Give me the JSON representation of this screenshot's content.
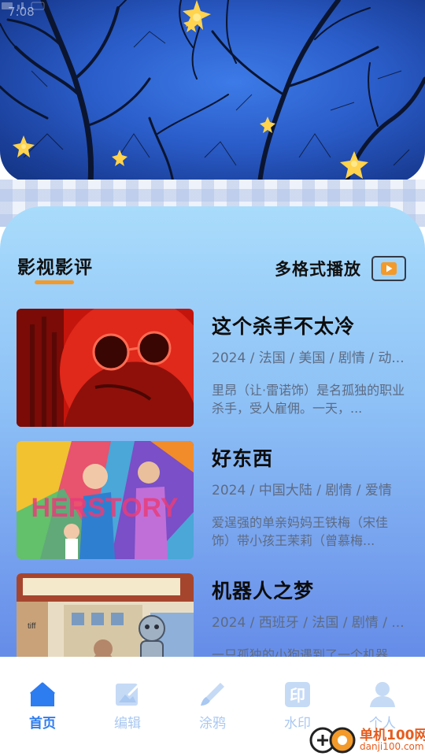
{
  "status_bar": {
    "time": "7:08"
  },
  "section": {
    "title": "影视影评",
    "action_label": "多格式播放"
  },
  "movies": [
    {
      "title": "这个杀手不太冷",
      "meta": "2024 / 法国 / 美国 / 剧情 / 动...",
      "desc": "里昂（让·雷诺饰）是名孤独的职业杀手，受人雇佣。一天，..."
    },
    {
      "title": "好东西",
      "meta": "2024 / 中国大陆 / 剧情 / 爱情",
      "desc": "爱逞强的单亲妈妈王铁梅（宋佳饰）带小孩王茉莉（曾慕梅...",
      "poster_text": "HERSTORY"
    },
    {
      "title": "机器人之梦",
      "meta": "2024 / 西班牙 / 法国 / 剧情 / ...",
      "desc": "一只孤独的小狗遇到了一个机器人..."
    }
  ],
  "nav": [
    {
      "label": "首页",
      "icon": "home-icon",
      "active": true
    },
    {
      "label": "编辑",
      "icon": "edit-image-icon",
      "active": false
    },
    {
      "label": "涂鸦",
      "icon": "brush-icon",
      "active": false
    },
    {
      "label": "水印",
      "icon": "stamp-icon",
      "active": false
    },
    {
      "label": "个人",
      "icon": "person-icon",
      "active": false
    }
  ],
  "watermark": {
    "name": "单机100网",
    "url": "danji100.com"
  },
  "colors": {
    "accent": "#2d7cf0",
    "underline": "#f39a2a",
    "nav_inactive": "#a9c8f2",
    "card_top": "#a9dcfb",
    "card_bottom": "#5f86e6"
  }
}
